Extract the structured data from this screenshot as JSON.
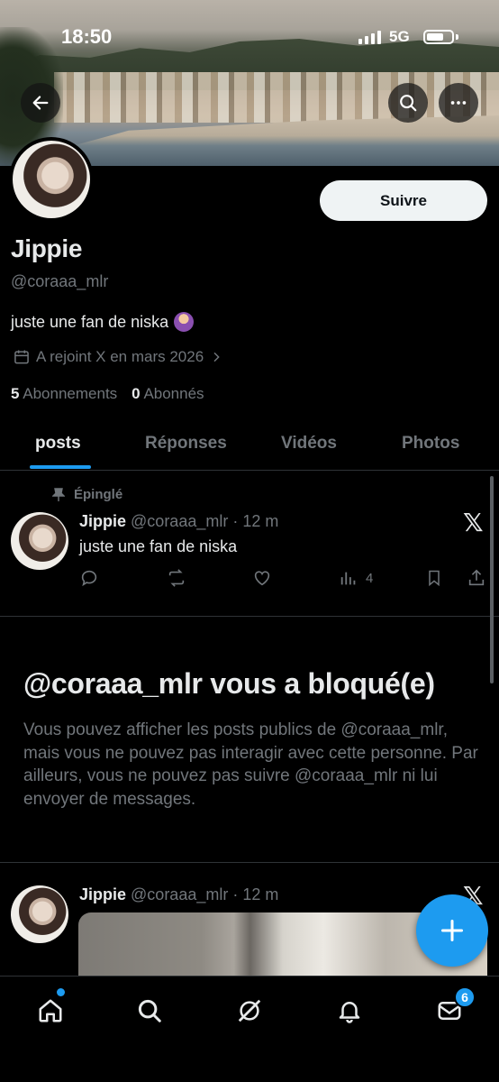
{
  "status": {
    "time": "18:50",
    "network": "5G"
  },
  "profile": {
    "name": "Jippie",
    "handle": "@coraaa_mlr",
    "bio": "juste une fan de niska",
    "joined": "A rejoint X en mars 2026",
    "following_count": "5",
    "following_label": "Abonnements",
    "followers_count": "0",
    "followers_label": "Abonnés",
    "follow_label": "Suivre"
  },
  "tabs": [
    {
      "label": "posts",
      "active": true
    },
    {
      "label": "Réponses",
      "active": false
    },
    {
      "label": "Vidéos",
      "active": false
    },
    {
      "label": "Photos",
      "active": false
    }
  ],
  "pinned_post": {
    "pinned_label": "Épinglé",
    "author": "Jippie",
    "handle_time": "@coraaa_mlr · 12 m",
    "text": "juste une fan de niska",
    "views": "4"
  },
  "blocked": {
    "title": "@coraaa_mlr vous a bloqué(e)",
    "text": "Vous pouvez afficher les posts publics de @coraaa_mlr, mais vous ne pouvez pas interagir avec cette personne. Par ailleurs, vous ne pouvez pas suivre @coraaa_mlr ni lui envoyer de messages."
  },
  "second_post": {
    "author": "Jippie",
    "handle_time": "@coraaa_mlr · 12 m"
  },
  "nav": {
    "messages_badge": "6"
  },
  "colors": {
    "accent": "#1d9bf0",
    "background": "#000000",
    "muted": "#71767b",
    "text": "#e7e9ea"
  },
  "icons": [
    "back-arrow-icon",
    "search-icon",
    "more-icon",
    "calendar-icon",
    "chevron-right-icon",
    "pin-icon",
    "x-logo-icon",
    "reply-icon",
    "repost-icon",
    "like-icon",
    "views-icon",
    "bookmark-icon",
    "share-icon",
    "compose-icon",
    "home-icon",
    "grok-icon",
    "notifications-icon",
    "messages-icon"
  ]
}
